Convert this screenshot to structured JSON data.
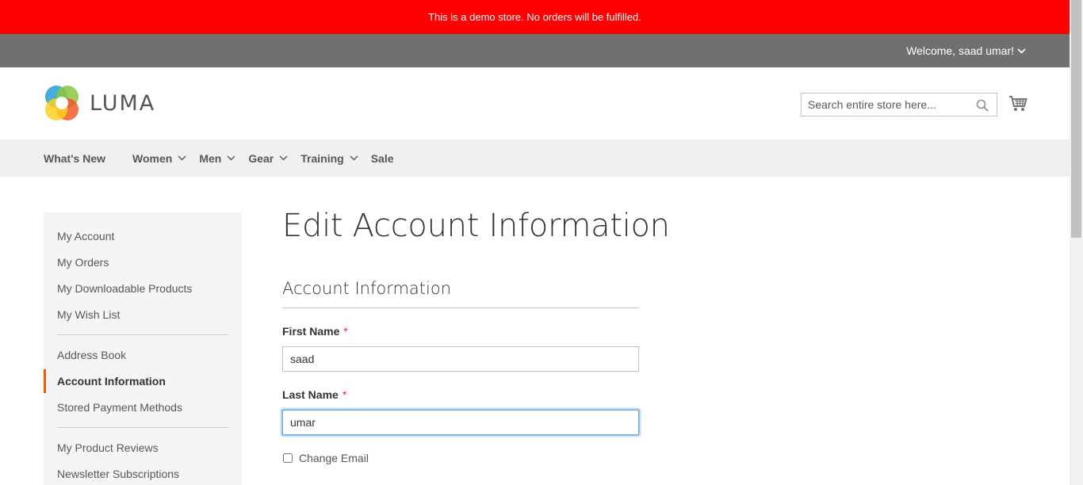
{
  "notice": {
    "text": "This is a demo store. No orders will be fulfilled."
  },
  "header": {
    "welcome": "Welcome, saad umar!",
    "logo_text": "LUMA",
    "search_placeholder": "Search entire store here..."
  },
  "nav": {
    "items": [
      {
        "label": "What's New"
      },
      {
        "label": "Women"
      },
      {
        "label": "Men"
      },
      {
        "label": "Gear"
      },
      {
        "label": "Training"
      },
      {
        "label": "Sale"
      }
    ]
  },
  "sidebar": {
    "items": [
      {
        "label": "My Account"
      },
      {
        "label": "My Orders"
      },
      {
        "label": "My Downloadable Products"
      },
      {
        "label": "My Wish List"
      },
      {
        "label": "Address Book"
      },
      {
        "label": "Account Information"
      },
      {
        "label": "Stored Payment Methods"
      },
      {
        "label": "My Product Reviews"
      },
      {
        "label": "Newsletter Subscriptions"
      }
    ]
  },
  "main": {
    "title": "Edit Account Information",
    "legend": "Account Information",
    "first_name_label": "First Name",
    "first_name_value": "saad",
    "last_name_label": "Last Name",
    "last_name_value": "umar",
    "required_mark": "*",
    "change_email_label": "Change Email"
  },
  "colors": {
    "notice_bg": "#ff0000",
    "panel_bg": "#6e716e",
    "nav_bg": "#f0f0f0",
    "accent": "#ff5501"
  }
}
